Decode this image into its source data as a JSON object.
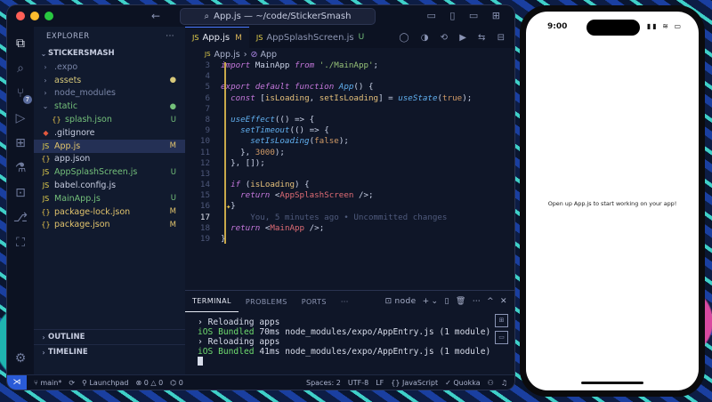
{
  "window": {
    "title": "App.js — ~/code/StickerSmash",
    "dot_colors": [
      "#ff5f57",
      "#febc2e",
      "#28c840"
    ]
  },
  "activity_bar": {
    "scm_badge": "7"
  },
  "sidebar": {
    "header": "EXPLORER",
    "header_more": "···",
    "project": "STICKERSMASH",
    "outline": "OUTLINE",
    "timeline": "TIMELINE",
    "items": [
      {
        "name": ".expo",
        "type": "folder",
        "status": "",
        "color": "#7a86a8",
        "icon": "›",
        "icon_color": "#7a86a8",
        "indent": 0
      },
      {
        "name": "assets",
        "type": "folder",
        "status": "●",
        "color": "#d7c87a",
        "icon": "›",
        "icon_color": "#8a94b4",
        "indent": 0
      },
      {
        "name": "node_modules",
        "type": "folder",
        "status": "",
        "color": "#7a86a8",
        "icon": "›",
        "icon_color": "#8a94b4",
        "indent": 0
      },
      {
        "name": "static",
        "type": "folder-open",
        "status": "●",
        "color": "#74c07a",
        "icon": "⌄",
        "icon_color": "#8a94b4",
        "indent": 0
      },
      {
        "name": "splash.json",
        "type": "json",
        "status": "U",
        "color": "#74c07a",
        "icon": "{}",
        "icon_color": "#e8c44d",
        "indent": 1
      },
      {
        "name": ".gitignore",
        "type": "git",
        "status": "",
        "color": "#c7cde0",
        "icon": "◆",
        "icon_color": "#e2583e",
        "indent": 0
      },
      {
        "name": "App.js",
        "type": "js",
        "status": "M",
        "color": "#e2c46d",
        "icon": "JS",
        "icon_color": "#e8d44d",
        "indent": 0
      },
      {
        "name": "app.json",
        "type": "json",
        "status": "",
        "color": "#c7cde0",
        "icon": "{}",
        "icon_color": "#e8c44d",
        "indent": 0
      },
      {
        "name": "AppSplashScreen.js",
        "type": "js",
        "status": "U",
        "color": "#74c07a",
        "icon": "JS",
        "icon_color": "#e8d44d",
        "indent": 0
      },
      {
        "name": "babel.config.js",
        "type": "js",
        "status": "",
        "color": "#c7cde0",
        "icon": "JS",
        "icon_color": "#e8d44d",
        "indent": 0
      },
      {
        "name": "MainApp.js",
        "type": "js",
        "status": "U",
        "color": "#74c07a",
        "icon": "JS",
        "icon_color": "#e8d44d",
        "indent": 0
      },
      {
        "name": "package-lock.json",
        "type": "json",
        "status": "M",
        "color": "#e2c46d",
        "icon": "{}",
        "icon_color": "#e8c44d",
        "indent": 0
      },
      {
        "name": "package.json",
        "type": "json",
        "status": "M",
        "color": "#e2c46d",
        "icon": "{}",
        "icon_color": "#e8c44d",
        "indent": 0
      }
    ]
  },
  "tabs": [
    {
      "label": "App.js",
      "badge": "M",
      "active": true
    },
    {
      "label": "AppSplashScreen.js",
      "badge": "U",
      "active": false
    }
  ],
  "breadcrumb": {
    "file": "App.js",
    "separator": "›",
    "symbol": "App"
  },
  "editor": {
    "lines": [
      {
        "n": "3",
        "html": "<span class='kw'>import</span> MainApp <span class='kw'>from</span> <span class='str'>'./MainApp'</span>;"
      },
      {
        "n": "4",
        "html": ""
      },
      {
        "n": "5",
        "html": "<span class='kw'>export default function</span> <span class='fn'>App</span>() {"
      },
      {
        "n": "6",
        "html": "  <span class='kw'>const</span> [<span class='var'>isLoading</span>, <span class='var'>setIsLoading</span>] = <span class='fn'>useState</span>(<span class='num'>true</span>);"
      },
      {
        "n": "7",
        "html": ""
      },
      {
        "n": "8",
        "html": "  <span class='fn'>useEffect</span>(() => {"
      },
      {
        "n": "9",
        "html": "    <span class='fn'>setTimeout</span>(() => {"
      },
      {
        "n": "10",
        "html": "      <span class='fn'>setIsLoading</span>(<span class='num'>false</span>);"
      },
      {
        "n": "11",
        "html": "    }, <span class='num'>3000</span>);"
      },
      {
        "n": "12",
        "html": "  }, []);"
      },
      {
        "n": "13",
        "html": ""
      },
      {
        "n": "14",
        "html": "  <span class='kw'>if</span> (<span class='var'>isLoading</span>) {"
      },
      {
        "n": "15",
        "html": "    <span class='kw'>return</span> &lt;<span class='tag'>AppSplashScreen</span> /&gt;;"
      },
      {
        "n": "16",
        "html": "  }"
      },
      {
        "n": "17",
        "html": "      <span class='ghost'>You, 5 minutes ago • Uncommitted changes</span>",
        "current": true
      },
      {
        "n": "18",
        "html": "  <span class='kw'>return</span> &lt;<span class='tag'>MainApp</span> /&gt;;"
      },
      {
        "n": "19",
        "html": "}"
      }
    ]
  },
  "panel": {
    "tabs": [
      "TERMINAL",
      "PROBLEMS",
      "PORTS"
    ],
    "more": "···",
    "terminal_name": "node",
    "actions": [
      "+",
      "⌄",
      "▯",
      "🗑",
      "⋯",
      "^",
      "✕"
    ],
    "lines": [
      {
        "prefix": "› ",
        "green": "",
        "text": "Reloading apps"
      },
      {
        "prefix": "",
        "green": "iOS Bundled",
        "text": " 70ms node_modules/expo/AppEntry.js (1 module)"
      },
      {
        "prefix": "› ",
        "green": "",
        "text": "Reloading apps"
      },
      {
        "prefix": "",
        "green": "iOS Bundled",
        "text": " 41ms node_modules/expo/AppEntry.js (1 module)"
      }
    ]
  },
  "statusbar": {
    "branch": "main*",
    "sync": "⟳",
    "launchpad": "Launchpad",
    "errors": "0",
    "warnings": "0",
    "ports": "0",
    "spaces": "Spaces: 2",
    "encoding": "UTF-8",
    "eol": "LF",
    "language": "JavaScript",
    "quokka": "Quokka"
  },
  "phone": {
    "time": "9:00",
    "status_icons": "▮▮ ≋ ▭",
    "message": "Open up App.js to start working on your app!"
  }
}
